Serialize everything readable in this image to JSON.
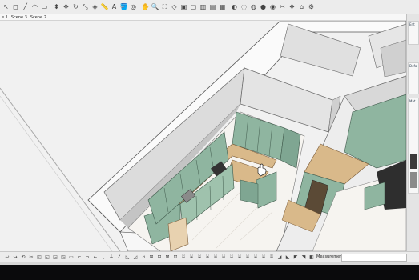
{
  "top_toolbar": {
    "icons": [
      "select-icon",
      "eraser-icon",
      "line-icon",
      "arc-icon",
      "rectangle-icon",
      "push-pull-icon",
      "move-icon",
      "rotate-icon",
      "scale-icon",
      "offset-icon",
      "tape-measure-icon",
      "text-icon",
      "paint-bucket-icon",
      "orbit-icon",
      "pan-icon",
      "zoom-icon",
      "zoom-extents-icon",
      "iso-view-icon",
      "top-view-icon",
      "front-view-icon",
      "right-view-icon",
      "back-view-icon",
      "left-view-icon",
      "xray-icon",
      "wireframe-icon",
      "hidden-line-icon",
      "shaded-icon",
      "textured-icon",
      "section-plane-icon",
      "components-icon",
      "warehouse-icon",
      "extension-icon"
    ]
  },
  "scene_tabs": [
    "e 1",
    "Scene 3",
    "Scene 2"
  ],
  "tray": {
    "panels": [
      {
        "title": "Ent"
      },
      {
        "title": "Defa"
      },
      {
        "title": "Mat"
      }
    ]
  },
  "status_bar": {
    "measurements_label": "Measurements",
    "measurements_value": ""
  },
  "colors": {
    "cabinet_green": "#8fb5a0",
    "counter_wood": "#d9b98a",
    "floor_marble": "#f4f2ee",
    "wall_face": "#d6d6d6",
    "wall_top": "#fbfbfb"
  }
}
